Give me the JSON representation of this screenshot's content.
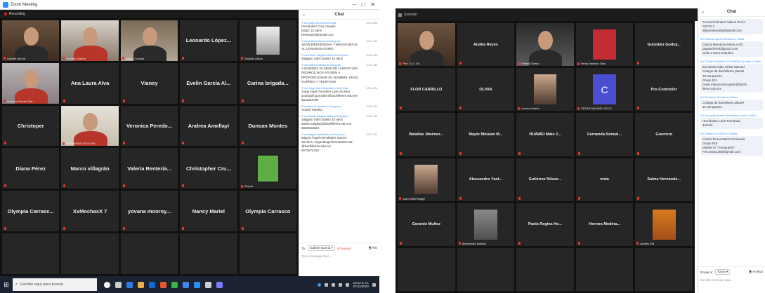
{
  "left": {
    "window_title": "Zoom Meeting",
    "window_controls": [
      "–",
      "□",
      "✕"
    ],
    "recording_label": "Recording",
    "tiles": [
      {
        "name": "",
        "caption": "Gabriel García",
        "video": "v-man1",
        "active": true
      },
      {
        "name": "",
        "caption": "Roberto García",
        "video": "v-man2"
      },
      {
        "name": "",
        "caption": "Leticia Cuevas",
        "video": "v-woman1"
      },
      {
        "name": "Leonardo López..."
      },
      {
        "name": "",
        "caption": "Gerardo Arturo",
        "image": "img-poster"
      },
      {
        "name": "",
        "caption": "Amparo García Ortiz",
        "video": "v-girl"
      },
      {
        "name": "Ana Laura Alva"
      },
      {
        "name": "Vianey"
      },
      {
        "name": "Evelin García Al..."
      },
      {
        "name": "Carina brigada..."
      },
      {
        "name": "Christoper"
      },
      {
        "name": "",
        "caption": "FERNANDO AGUILAR",
        "video": "v-woman2"
      },
      {
        "name": "Veronica Peredo..."
      },
      {
        "name": "Andrea Amellayi"
      },
      {
        "name": "Duncan Montes"
      },
      {
        "name": "Diana Pérez"
      },
      {
        "name": "Marco villagrán"
      },
      {
        "name": "Valeria Rentería..."
      },
      {
        "name": "Christopher Cru..."
      },
      {
        "name": "",
        "caption": "Sheyla",
        "image": "img-green"
      },
      {
        "name": "Olympia Carrasc..."
      },
      {
        "name": "XxMochaxX 7"
      },
      {
        "name": "yovana monroy..."
      },
      {
        "name": "Nancy Mariel"
      },
      {
        "name": "Olympia Carrasco"
      },
      {
        "name": ""
      },
      {
        "name": ""
      },
      {
        "name": ""
      },
      {
        "name": ""
      },
      {
        "name": ""
      }
    ],
    "chat": {
      "title": "Chat",
      "messages": [
        {
          "from": "From Nayel Cruz to Everyone",
          "time": "10:10 AM",
          "text": "Hernández Cruz Anayeli\nEdad: 22 años\nheranayeli@gmail.com"
        },
        {
          "from": "From Gabriel García to Everyone",
          "time": "10:10 AM",
          "text": "SEAN BIENVENIDAS Y BIENVENIDOS\nAL CONVERSATORIO"
        },
        {
          "from": "From Danilo Salgado Solís to Everyone",
          "time": "10:10 AM",
          "text": "Salgado Solís Danilo 15 años"
        },
        {
          "from": "From Gabriel García to Everyone",
          "time": "10:11 AM",
          "text": "A QUIENES ACABAN DE LLEGAR LES\nPEDIMOS NOS AYUDEN A\nPROPORCIONAR SU NOMBRE, EDAD,\nCORREO Y TELÉFONO"
        },
        {
          "from": "From Jorge Gael González to Everyone",
          "time": "10:11 AM",
          "text": "Jorge Gael González Lara 16 años\njorgegael.gonzalez@bachilleres.edu.mx\n5611028761"
        },
        {
          "from": "From Anacel Medina to Everyone",
          "time": "10:11 AM",
          "text": "Anacel Medina"
        },
        {
          "from": "From Danilo Salgado Solís to Everyone",
          "time": "10:11 AM",
          "text": "Salgado Solís Danilo 15 años\ndanilo.salgado@bachilleres.edu.mx\n5560942823"
        },
        {
          "from": "From Miguel Hernández to Everyone",
          "time": "10:12 AM",
          "text": "Miguel Ángel Hernández García\n18 años, miguelangel.hernandez142\n@bachilleres.edu.mx\n5573672415"
        }
      ],
      "to_label": "To:",
      "to_value": "Gabriel García ▾",
      "private_label": "(Privately)",
      "file_label": "File",
      "input_placeholder": "Type message here..."
    },
    "taskbar": {
      "search_placeholder": "Escribe aquí para buscar",
      "clock_time": "10:12 a. m.",
      "clock_date": "07/11/2020"
    }
  },
  "right": {
    "top_label": "Gonzalo",
    "tiles": [
      {
        "name": "",
        "caption": "Prof. G.O. Sil",
        "video": "v-man1",
        "active": true
      },
      {
        "name": "Andira Reyes"
      },
      {
        "name": "",
        "caption": "Rafael Olvedo",
        "video": "v-man3"
      },
      {
        "name": "",
        "caption": "Heidy Bautista Díaz",
        "image": "img-red"
      },
      {
        "name": "González Godoy..."
      },
      {
        "name": "FLOR CARRILLO"
      },
      {
        "name": "OLIVIA"
      },
      {
        "name": "",
        "caption": "Lenovo Interia",
        "image": "img-face"
      },
      {
        "name": "",
        "caption": "CÉSAR MANUEL ESCO...",
        "image": "img-c",
        "letter": "C"
      },
      {
        "name": "Pro-Controller"
      },
      {
        "name": "Balañas Jiménez..."
      },
      {
        "name": "Mayte Micalan M..."
      },
      {
        "name": "HUAWEI Mate 2..."
      },
      {
        "name": "Fernanda Sonsal..."
      },
      {
        "name": "Guerrero"
      },
      {
        "name": "",
        "caption": "Juan Vidal Rangel",
        "image": "img-face"
      },
      {
        "name": "Alessandro Yaot..."
      },
      {
        "name": "Gutiérrez Nilsso..."
      },
      {
        "name": "maia"
      },
      {
        "name": "Salma Hernánde..."
      },
      {
        "name": "Gerardo Muñoz"
      },
      {
        "name": "",
        "caption": "Alessandra Molinar",
        "image": "img-grey"
      },
      {
        "name": "Paola Regina Ho..."
      },
      {
        "name": "Herrera Medina..."
      },
      {
        "name": "",
        "caption": "Andrés EM",
        "image": "img-group"
      },
      {
        "name": ""
      },
      {
        "name": ""
      },
      {
        "name": ""
      },
      {
        "name": ""
      },
      {
        "name": ""
      }
    ],
    "chat": {
      "title": "Chat",
      "messages": [
        {
          "from": "",
          "text": "Coronel Méndez Galicia Rocío\nCETIS 3\nallyserabanalar@gmail.com"
        },
        {
          "from": "De Rebeca García Mendoza a Todos",
          "text": "García Mendoza Rebeca (R)\npapaxelTs78@gmail.com\nCetis 1 turno matutino"
        },
        {
          "from": "De CÉSAR MANUEL ESCOBEDO (iLucid) a Todos",
          "text": "Escobedo Islas César Manuel\nColegio de Bachilleres plantel\n10 aeropuerto\nGrupo 511\ncesar.manuel.escogedo@bachi\nlleres.edu.mx"
        },
        {
          "from": "De Fernando González a Todos",
          "text": "Colegio de bachilleres plantel\n10 aeropuerto"
        },
        {
          "from": "De Fernanda Jazmín Hernández León a Todos",
          "text": "Hernández León Fernanda\nJazmín"
        },
        {
          "from": "De Galaxy A1 (CETIS a Todos)",
          "text": "Cortés Flores María Fernanda\nGrupo 519\nplantel 10 \"Aeropuerto\"\nFercortes1306@gmail.com"
        }
      ],
      "to_label": "Enviar a:",
      "to_value": "Todos ▾",
      "file_label": "Archivo",
      "input_placeholder": "Escribir mensaje aquí..."
    }
  }
}
